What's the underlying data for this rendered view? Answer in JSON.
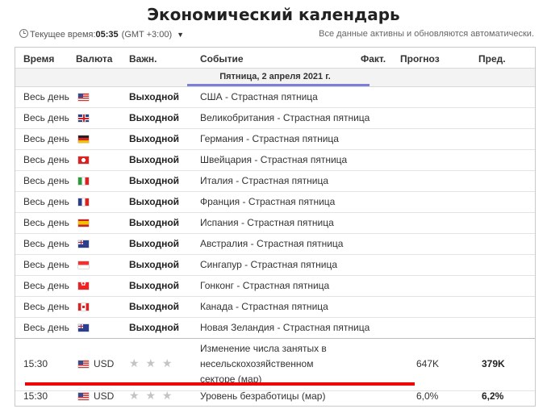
{
  "page": {
    "title": "Экономический календарь",
    "time_label": "Текущее время:",
    "time_value": "05:35",
    "timezone": "(GMT +3:00)",
    "auto_update_note": "Все данные активны и обновляются автоматически."
  },
  "table": {
    "headers": {
      "time": "Время",
      "currency": "Валюта",
      "importance": "Важн.",
      "event": "Событие",
      "actual": "Факт.",
      "forecast": "Прогноз",
      "previous": "Пред."
    },
    "day": "Пятница, 2 апреля 2021 г.",
    "holiday_rows": [
      {
        "time": "Весь день",
        "flag": "us-flag",
        "importance": "Выходной",
        "event": "США - Страстная пятница"
      },
      {
        "time": "Весь день",
        "flag": "gb-flag",
        "importance": "Выходной",
        "event": "Великобритания - Страстная пятница"
      },
      {
        "time": "Весь день",
        "flag": "de-flag",
        "importance": "Выходной",
        "event": "Германия - Страстная пятница"
      },
      {
        "time": "Весь день",
        "flag": "ch-flag",
        "importance": "Выходной",
        "event": "Швейцария - Страстная пятница"
      },
      {
        "time": "Весь день",
        "flag": "it-flag",
        "importance": "Выходной",
        "event": "Италия - Страстная пятница"
      },
      {
        "time": "Весь день",
        "flag": "fr-flag",
        "importance": "Выходной",
        "event": "Франция - Страстная пятница"
      },
      {
        "time": "Весь день",
        "flag": "es-flag",
        "importance": "Выходной",
        "event": "Испания - Страстная пятница"
      },
      {
        "time": "Весь день",
        "flag": "au-flag",
        "importance": "Выходной",
        "event": "Австралия - Страстная пятница"
      },
      {
        "time": "Весь день",
        "flag": "sg-flag",
        "importance": "Выходной",
        "event": "Сингапур - Страстная пятница"
      },
      {
        "time": "Весь день",
        "flag": "hk-flag",
        "importance": "Выходной",
        "event": "Гонконг - Страстная пятница"
      },
      {
        "time": "Весь день",
        "flag": "ca-flag",
        "importance": "Выходной",
        "event": "Канада - Страстная пятница"
      },
      {
        "time": "Весь день",
        "flag": "nz-flag",
        "importance": "Выходной",
        "event": "Новая Зеландия - Страстная пятница"
      }
    ],
    "event_rows": [
      {
        "time": "15:30",
        "flag": "us-flag",
        "currency": "USD",
        "stars": "★ ★ ★",
        "event_lines": [
          "Изменение числа занятых в",
          "несельскохозяйственном",
          "секторе (мар)"
        ],
        "actual": "",
        "forecast": "647K",
        "previous": "379K"
      },
      {
        "time": "15:30",
        "flag": "us-flag",
        "currency": "USD",
        "stars": "★ ★ ★",
        "event": "Уровень безработицы (мар)",
        "actual": "",
        "forecast": "6,0%",
        "previous": "6,2%"
      }
    ]
  },
  "colors": {
    "day_underline": "#7b7fd8",
    "highlight_underline": "#ee0000"
  }
}
